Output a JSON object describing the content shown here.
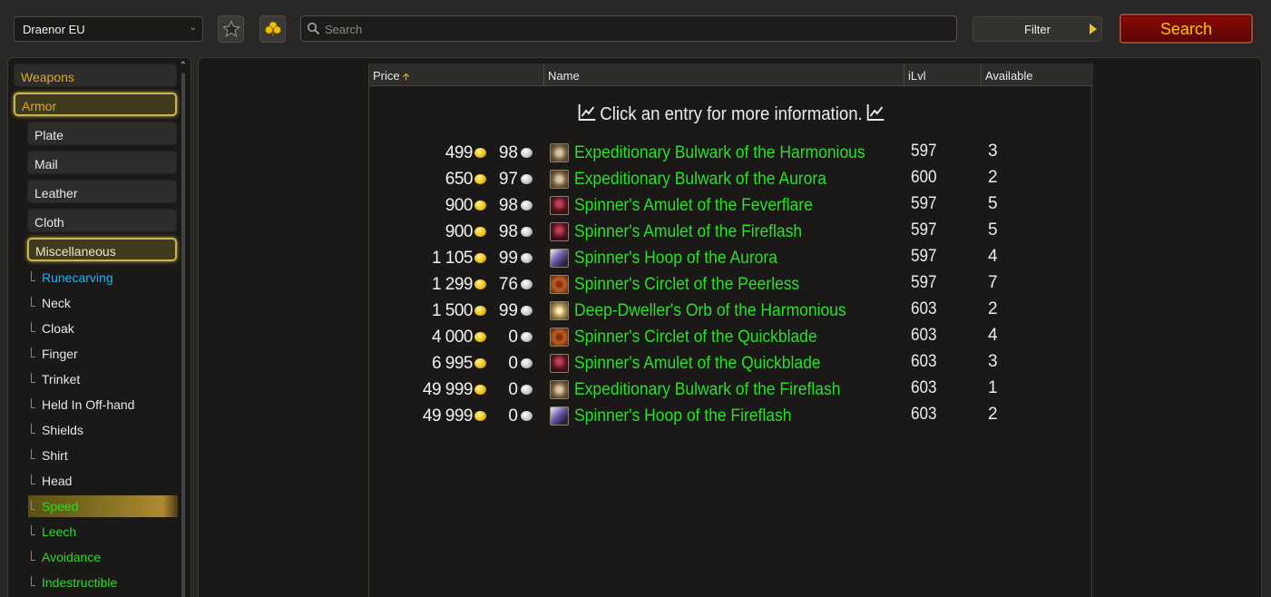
{
  "topbar": {
    "realm": "Draenor EU",
    "search_placeholder": "Search",
    "filter_label": "Filter",
    "search_button": "Search"
  },
  "sidebar": {
    "categories": [
      {
        "label": "Weapons"
      },
      {
        "label": "Armor"
      },
      {
        "label": "Plate"
      },
      {
        "label": "Mail"
      },
      {
        "label": "Leather"
      },
      {
        "label": "Cloth"
      },
      {
        "label": "Miscellaneous"
      }
    ],
    "subcategories": [
      {
        "label": "Runecarving"
      },
      {
        "label": "Neck"
      },
      {
        "label": "Cloak"
      },
      {
        "label": "Finger"
      },
      {
        "label": "Trinket"
      },
      {
        "label": "Held In Off-hand"
      },
      {
        "label": "Shields"
      },
      {
        "label": "Shirt"
      },
      {
        "label": "Head"
      },
      {
        "label": "Speed"
      },
      {
        "label": "Leech"
      },
      {
        "label": "Avoidance"
      },
      {
        "label": "Indestructible"
      }
    ]
  },
  "table": {
    "headers": {
      "price": "Price",
      "name": "Name",
      "ilvl": "iLvl",
      "available": "Available"
    },
    "info": "Click an entry for more information.",
    "rows": [
      {
        "gold": "499",
        "silver": "98",
        "name": "Expeditionary Bulwark of the Harmonious",
        "ilvl": "597",
        "available": "3",
        "icon": "bulwark-icon"
      },
      {
        "gold": "650",
        "silver": "97",
        "name": "Expeditionary Bulwark of the Aurora",
        "ilvl": "600",
        "available": "2",
        "icon": "bulwark-icon"
      },
      {
        "gold": "900",
        "silver": "98",
        "name": "Spinner's Amulet of the Feverflare",
        "ilvl": "597",
        "available": "5",
        "icon": "amulet-icon"
      },
      {
        "gold": "900",
        "silver": "98",
        "name": "Spinner's Amulet of the Fireflash",
        "ilvl": "597",
        "available": "5",
        "icon": "amulet-icon"
      },
      {
        "gold": "1 105",
        "silver": "99",
        "name": "Spinner's Hoop of the Aurora",
        "ilvl": "597",
        "available": "4",
        "icon": "hoop-icon"
      },
      {
        "gold": "1 299",
        "silver": "76",
        "name": "Spinner's Circlet of the Peerless",
        "ilvl": "597",
        "available": "7",
        "icon": "circlet-icon"
      },
      {
        "gold": "1 500",
        "silver": "99",
        "name": "Deep-Dweller's Orb of the Harmonious",
        "ilvl": "603",
        "available": "2",
        "icon": "orb-icon"
      },
      {
        "gold": "4 000",
        "silver": "0",
        "name": "Spinner's Circlet of the Quickblade",
        "ilvl": "603",
        "available": "4",
        "icon": "circlet-icon"
      },
      {
        "gold": "6 995",
        "silver": "0",
        "name": "Spinner's Amulet of the Quickblade",
        "ilvl": "603",
        "available": "3",
        "icon": "amulet-icon"
      },
      {
        "gold": "49 999",
        "silver": "0",
        "name": "Expeditionary Bulwark of the Fireflash",
        "ilvl": "603",
        "available": "1",
        "icon": "bulwark-icon"
      },
      {
        "gold": "49 999",
        "silver": "0",
        "name": "Spinner's Hoop of the Fireflash",
        "ilvl": "603",
        "available": "2",
        "icon": "hoop-icon"
      }
    ]
  },
  "colors": {
    "accent_gold": "#f5c400",
    "item_green": "#28e028",
    "link_blue": "#24b0f0",
    "search_button_red": "#7a0805"
  }
}
